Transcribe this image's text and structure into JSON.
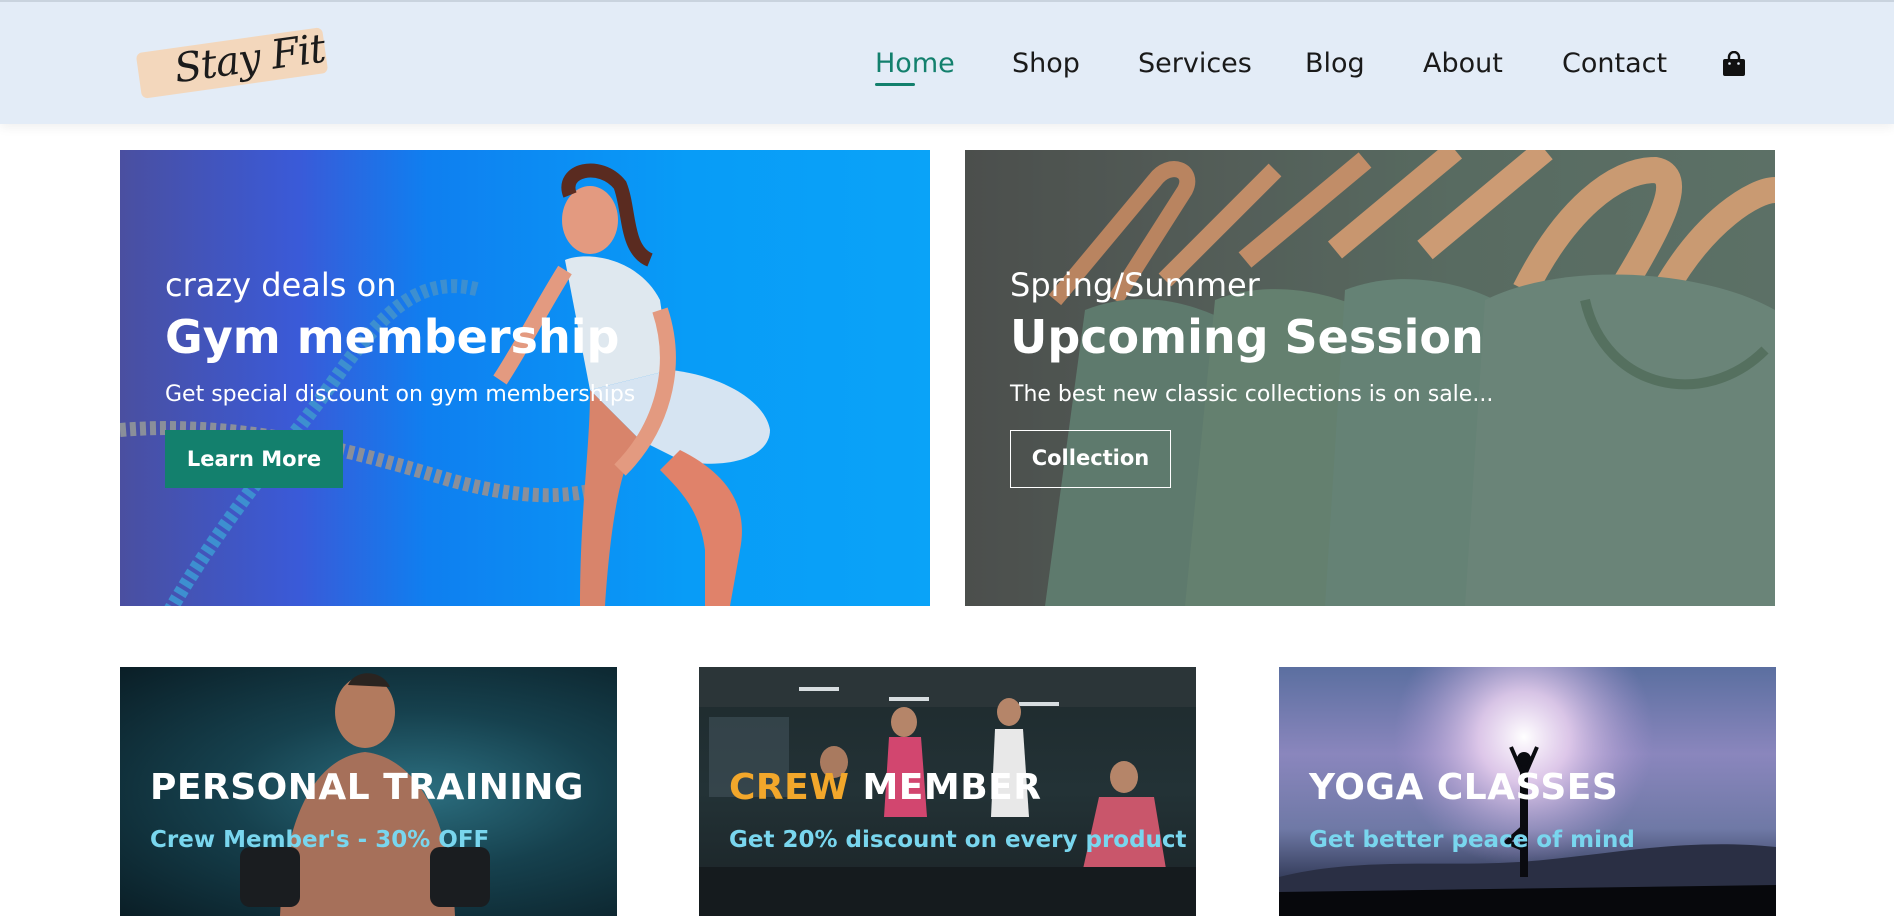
{
  "header": {
    "logo_text": "Stay Fit",
    "nav": [
      {
        "label": "Home",
        "active": true
      },
      {
        "label": "Shop",
        "active": false
      },
      {
        "label": "Services",
        "active": false
      },
      {
        "label": "Blog",
        "active": false
      },
      {
        "label": "About",
        "active": false
      },
      {
        "label": "Contact",
        "active": false
      }
    ],
    "cart_icon": "shopping-bag-icon"
  },
  "banners": [
    {
      "subtitle": "crazy deals on",
      "title": "Gym membership",
      "description": "Get special discount on gym memberships",
      "button_label": "Learn More"
    },
    {
      "subtitle": "Spring/Summer",
      "title": "Upcoming Session",
      "description": "The best new classic collections is on sale...",
      "button_label": "Collection"
    }
  ],
  "cards": [
    {
      "title": "PERSONAL TRAINING",
      "subtitle": "Crew Member's - 30% OFF"
    },
    {
      "title_accent": "CREW",
      "title_rest": " MEMBER",
      "subtitle": "Get 20% discount on every product"
    },
    {
      "title": "YOGA CLASSES",
      "subtitle": "Get better peace of mind"
    }
  ],
  "colors": {
    "accent": "#13806d",
    "header_bg": "#e3ecf7",
    "card_subtitle": "#79d6ee",
    "crew_accent": "#f2a72b"
  }
}
